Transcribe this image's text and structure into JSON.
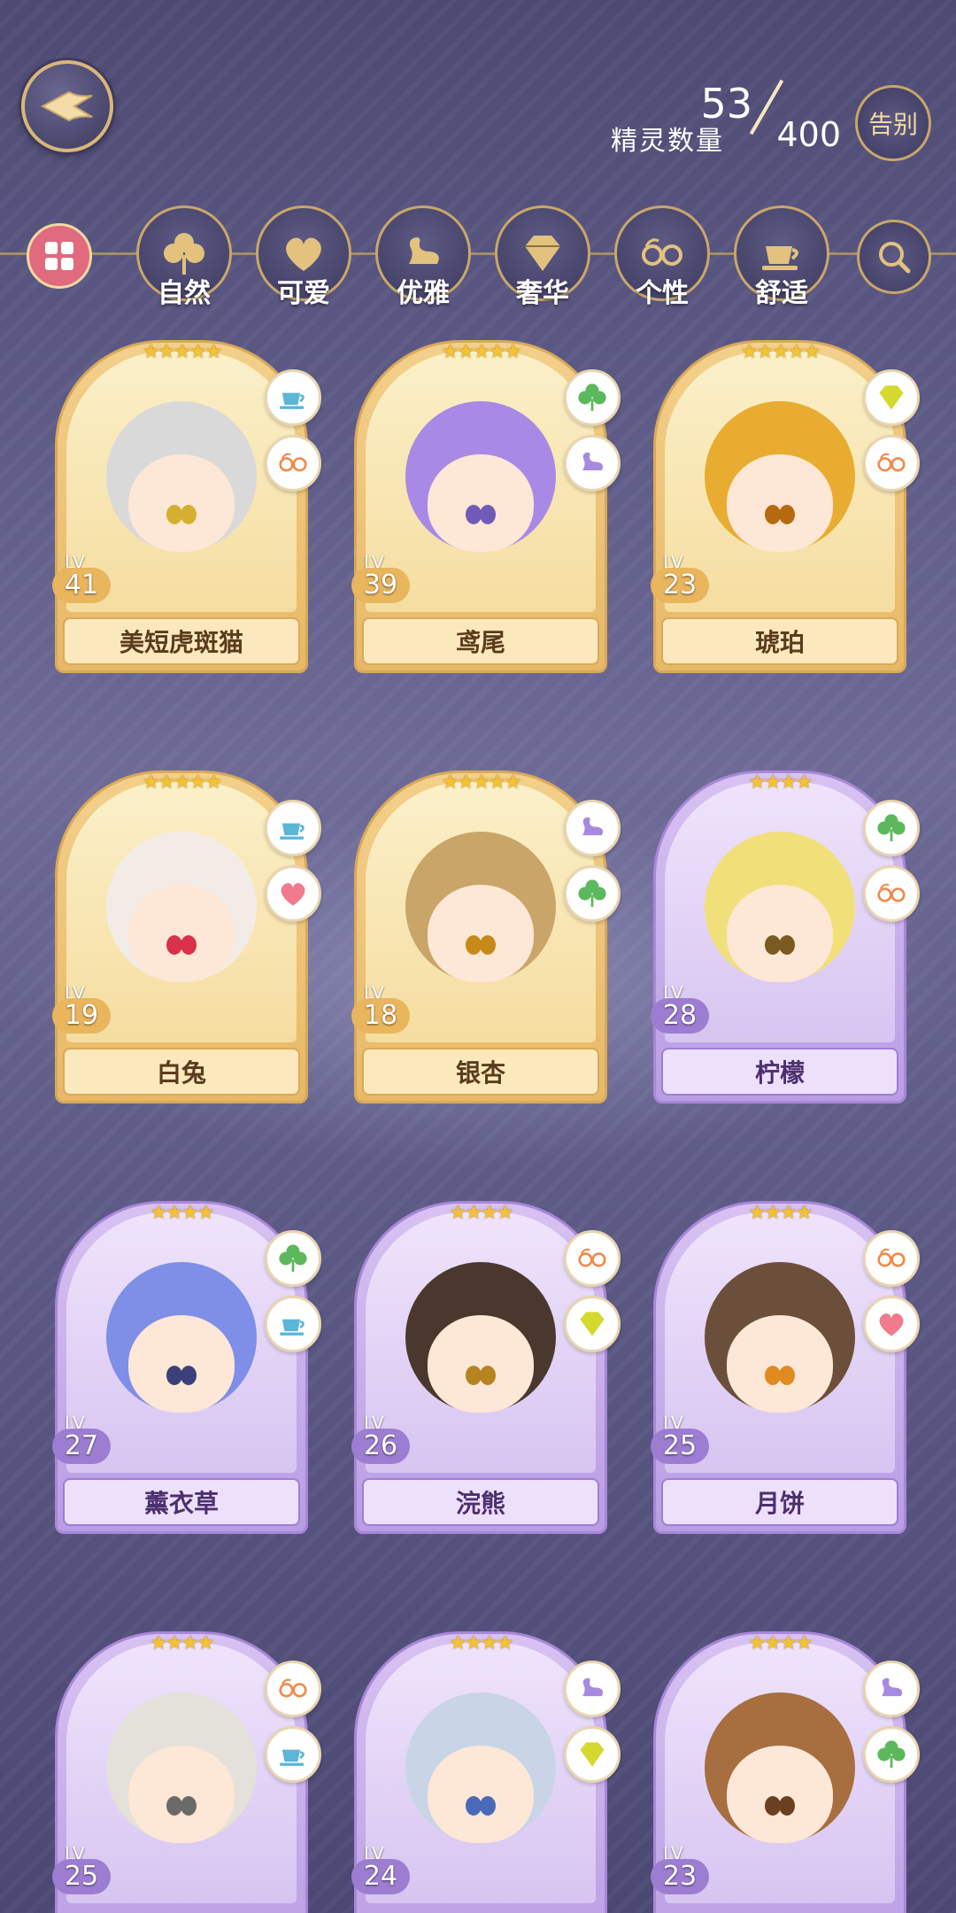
{
  "header": {
    "count_current": "53",
    "count_label": "精灵数量",
    "count_total": "400",
    "farewell_label": "告别"
  },
  "filters": [
    {
      "label": "自然",
      "icon": "clover-icon"
    },
    {
      "label": "可爱",
      "icon": "heart-icon"
    },
    {
      "label": "优雅",
      "icon": "swan-icon"
    },
    {
      "label": "奢华",
      "icon": "diamond-icon"
    },
    {
      "label": "个性",
      "icon": "glasses-icon"
    },
    {
      "label": "舒适",
      "icon": "teacup-icon"
    }
  ],
  "colors": {
    "gold_card": "#f3d08b",
    "purple_card": "#d8c2f2",
    "accent_gold": "#c9a76a",
    "all_filter": "#e06a7e"
  },
  "cards": [
    {
      "name": "美短虎斑猫",
      "level": "41",
      "stars": 5,
      "rarity": "gold",
      "traits": [
        "teacup-icon",
        "glasses-icon"
      ],
      "hair": "#d9d9d9",
      "eyes": "#d4b030"
    },
    {
      "name": "鸢尾",
      "level": "39",
      "stars": 5,
      "rarity": "gold",
      "traits": [
        "clover-icon",
        "swan-icon"
      ],
      "hair": "#a88ae6",
      "eyes": "#6f5ab8"
    },
    {
      "name": "琥珀",
      "level": "23",
      "stars": 5,
      "rarity": "gold",
      "traits": [
        "diamond-icon",
        "glasses-icon"
      ],
      "hair": "#e8ad30",
      "eyes": "#b56a10"
    },
    {
      "name": "白兔",
      "level": "19",
      "stars": 5,
      "rarity": "gold",
      "traits": [
        "teacup-icon",
        "heart-icon"
      ],
      "hair": "#f3ece6",
      "eyes": "#d8324a"
    },
    {
      "name": "银杏",
      "level": "18",
      "stars": 5,
      "rarity": "gold",
      "traits": [
        "swan-icon",
        "clover-icon"
      ],
      "hair": "#c9a56a",
      "eyes": "#c78a1a"
    },
    {
      "name": "柠檬",
      "level": "28",
      "stars": 4,
      "rarity": "purple",
      "traits": [
        "clover-icon",
        "glasses-icon"
      ],
      "hair": "#f1df7a",
      "eyes": "#7a5a20"
    },
    {
      "name": "薰衣草",
      "level": "27",
      "stars": 4,
      "rarity": "purple",
      "traits": [
        "clover-icon",
        "teacup-icon"
      ],
      "hair": "#7f8ee6",
      "eyes": "#3b3f7a"
    },
    {
      "name": "浣熊",
      "level": "26",
      "stars": 4,
      "rarity": "purple",
      "traits": [
        "glasses-icon",
        "diamond-icon"
      ],
      "hair": "#4a382e",
      "eyes": "#b58320"
    },
    {
      "name": "月饼",
      "level": "25",
      "stars": 4,
      "rarity": "purple",
      "traits": [
        "glasses-icon",
        "heart-icon"
      ],
      "hair": "#6b4f3a",
      "eyes": "#e08a20"
    },
    {
      "name": "",
      "level": "25",
      "stars": 4,
      "rarity": "purple",
      "traits": [
        "glasses-icon",
        "teacup-icon"
      ],
      "hair": "#e4e0da",
      "eyes": "#6a6a6a"
    },
    {
      "name": "",
      "level": "24",
      "stars": 4,
      "rarity": "purple",
      "traits": [
        "swan-icon",
        "diamond-icon"
      ],
      "hair": "#c9d4e6",
      "eyes": "#4a6ab8"
    },
    {
      "name": "",
      "level": "23",
      "stars": 4,
      "rarity": "purple",
      "traits": [
        "swan-icon",
        "clover-icon"
      ],
      "hair": "#a76e40",
      "eyes": "#6a4020"
    }
  ]
}
